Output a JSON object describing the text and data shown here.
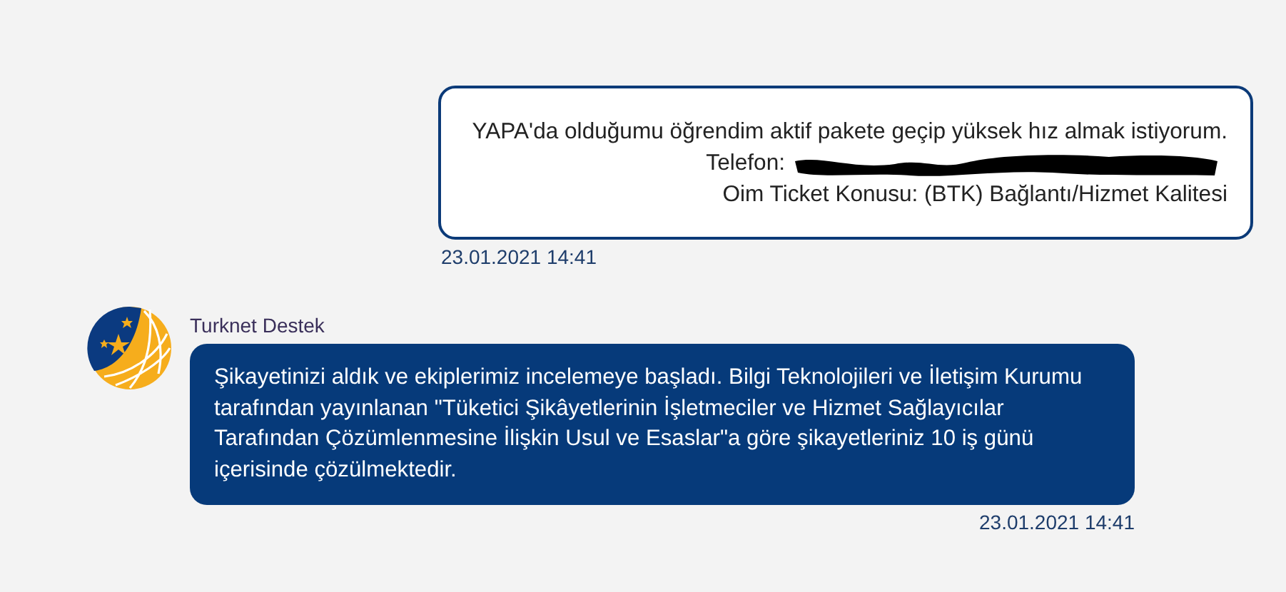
{
  "messages": [
    {
      "kind": "outgoing",
      "lines": [
        {
          "text": "YAPA'da olduğumu öğrendim aktif pakete geçip yüksek hız almak istiyorum.",
          "redacted": false
        },
        {
          "text": "Telefon:",
          "redacted": true
        },
        {
          "text": "Oim Ticket Konusu: (BTK) Bağlantı/Hizmet Kalitesi",
          "redacted": false
        }
      ],
      "time": "23.01.2021 14:41"
    },
    {
      "kind": "incoming",
      "sender": "Turknet Destek",
      "lines": [
        {
          "text": "Şikayetinizi aldık ve ekiplerimiz incelemeye başladı. Bilgi Teknolojileri ve İletişim Kurumu tarafından yayınlanan \"Tüketici Şikâyetlerinin İşletmeciler ve Hizmet Sağlayıcılar Tarafından Çözümlenmesine İlişkin Usul ve Esaslar\"a göre şikayetleriniz 10 iş günü içerisinde çözülmektedir.",
          "redacted": false
        }
      ],
      "time": "23.01.2021 14:41"
    }
  ]
}
